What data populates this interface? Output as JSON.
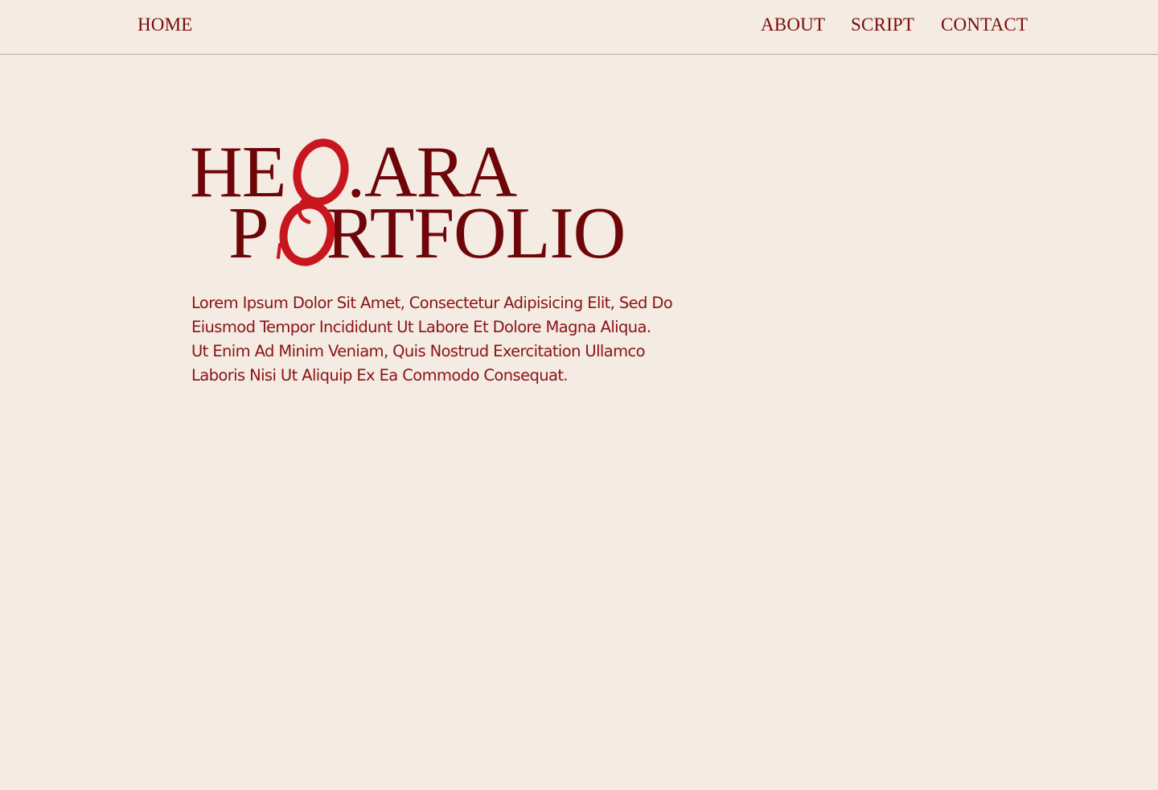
{
  "nav": {
    "home": "HOME",
    "about": "ABOUT",
    "script": "SCRIPT",
    "contact": "CONTACT"
  },
  "hero": {
    "title_line_1_start": "HE",
    "title_line_1_dot": ".",
    "title_line_1_end": "ARA",
    "title_line_2_start": "P",
    "title_line_2_end": "RTFOLIO",
    "title_icon": "glasses-icon",
    "body_lines": [
      "Lorem Ipsum Dolor Sit Amet, Consectetur Adipisicing Elit, Sed Do",
      "Eiusmod Tempor Incididunt Ut Labore Et Dolore Magna Aliqua.",
      "Ut Enim Ad Minim Veniam, Quis Nostrud Exercitation Ullamco",
      "Laboris Nisi Ut Aliquip Ex Ea Commodo Consequat."
    ]
  },
  "colors": {
    "background": "#f4ebe2",
    "nav_text": "#7a0a0a",
    "title": "#6e0508",
    "accent": "#c8161e",
    "body_text": "#8a1218",
    "divider": "#c4a49c"
  }
}
